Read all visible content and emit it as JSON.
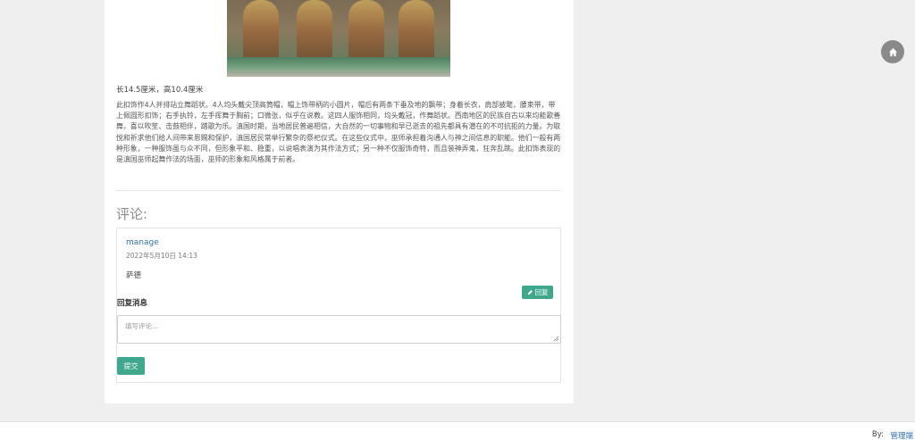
{
  "artifact": {
    "size_text": "长14.5厘米，高10.4厘米",
    "description": "此扣饰作4人并排站立舞蹈状。4人均头戴尖顶高筒帽，帽上饰带柄的小圆片，帽后有两条下垂及地的飘带；身着长衣，肩部披氅，腰束带，带上佩圆形扣饰；右手执铃，左手挥舞于胸前；口微张，似乎在说教。这四人服饰相同，均头戴冠，作舞蹈状。西南地区的民族自古以来均能歌善舞，喜以吹笙、击鼓相伴，踏歌为乐。滇国时期，当地居民普遍相信，大自然的一切事物和早已逝去的祖先都具有潜在的不可抗拒的力量。为取悦和祈求他们给人间带来恩赐和保护，滇国居民常举行繁杂的祭祀仪式。在这些仪式中，巫师承担着沟通人与神之间信息的职能。他们一般有两种形象，一种服饰虽与众不同，但形象平和、稳重，以说唱表演为其作法方式；另一种不仅服饰奇特，而且装神弄鬼，狂奔乱跳。此扣饰表现的是滇国巫师起舞作法的场面，巫师的形象和风格属于前者。"
  },
  "comments": {
    "heading": "评论:",
    "items": [
      {
        "user": "manage",
        "date": "2022年5月10日 14:13",
        "text": "萨德",
        "reply_label": "回复"
      }
    ],
    "reply_title": "回复消息",
    "reply_placeholder": "填写评论...",
    "submit_label": "提交"
  },
  "footer": {
    "by_label": "By:",
    "admin_link": "管理端"
  },
  "icons": {
    "home": "home-icon",
    "pencil": "pencil-icon"
  },
  "colors": {
    "accent": "#3ea78c",
    "link": "#2f6fb0"
  }
}
